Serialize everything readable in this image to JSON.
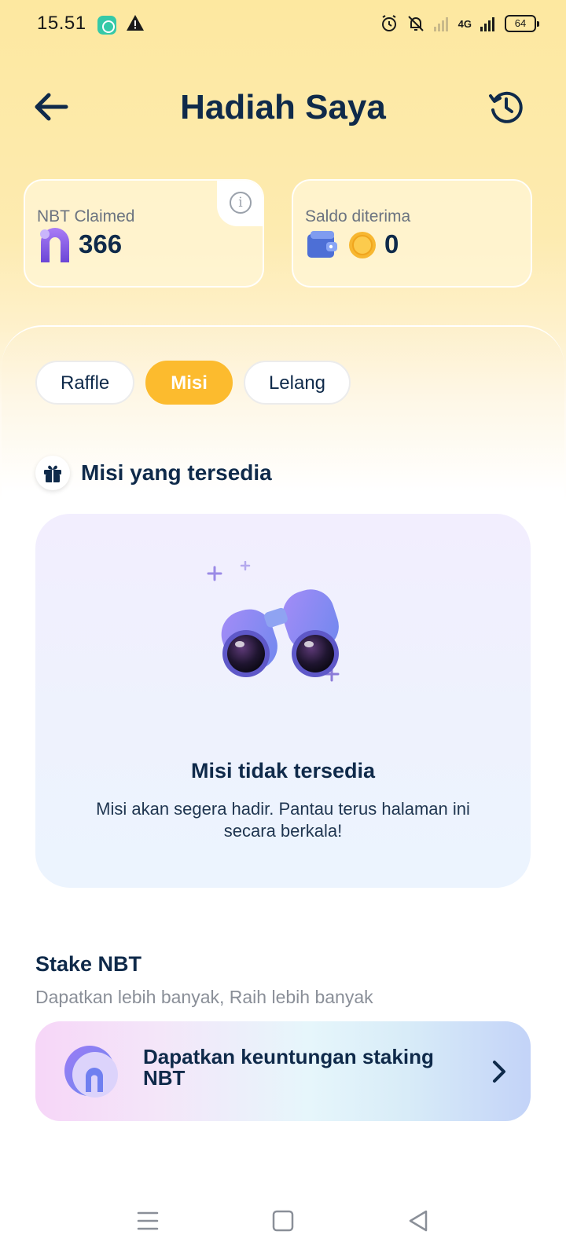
{
  "status_bar": {
    "time": "15.51",
    "network": "4G",
    "battery": "64",
    "icons": [
      "app-notification-icon",
      "warning-icon",
      "alarm-icon",
      "mute-icon",
      "signal-icon",
      "battery-icon"
    ]
  },
  "header": {
    "title": "Hadiah Saya",
    "back_icon": "arrow-left-icon",
    "history_icon": "history-clock-icon"
  },
  "cards": {
    "nbt_claimed": {
      "label": "NBT Claimed",
      "value": "366",
      "info_icon": "info-icon"
    },
    "saldo": {
      "label": "Saldo diterima",
      "value": "0"
    }
  },
  "tabs": [
    {
      "label": "Raffle",
      "active": false
    },
    {
      "label": "Misi",
      "active": true
    },
    {
      "label": "Lelang",
      "active": false
    }
  ],
  "missions": {
    "section_title": "Misi yang tersedia",
    "empty_title": "Misi tidak tersedia",
    "empty_description": "Misi akan segera hadir. Pantau terus halaman ini secara berkala!"
  },
  "stake": {
    "title": "Stake NBT",
    "subtitle": "Dapatkan lebih banyak, Raih lebih banyak",
    "banner_text": "Dapatkan keuntungan staking NBT"
  },
  "colors": {
    "primary_text": "#0f2a4a",
    "accent_yellow": "#fcbb2e",
    "nbt_purple": "#8a5cf0"
  }
}
